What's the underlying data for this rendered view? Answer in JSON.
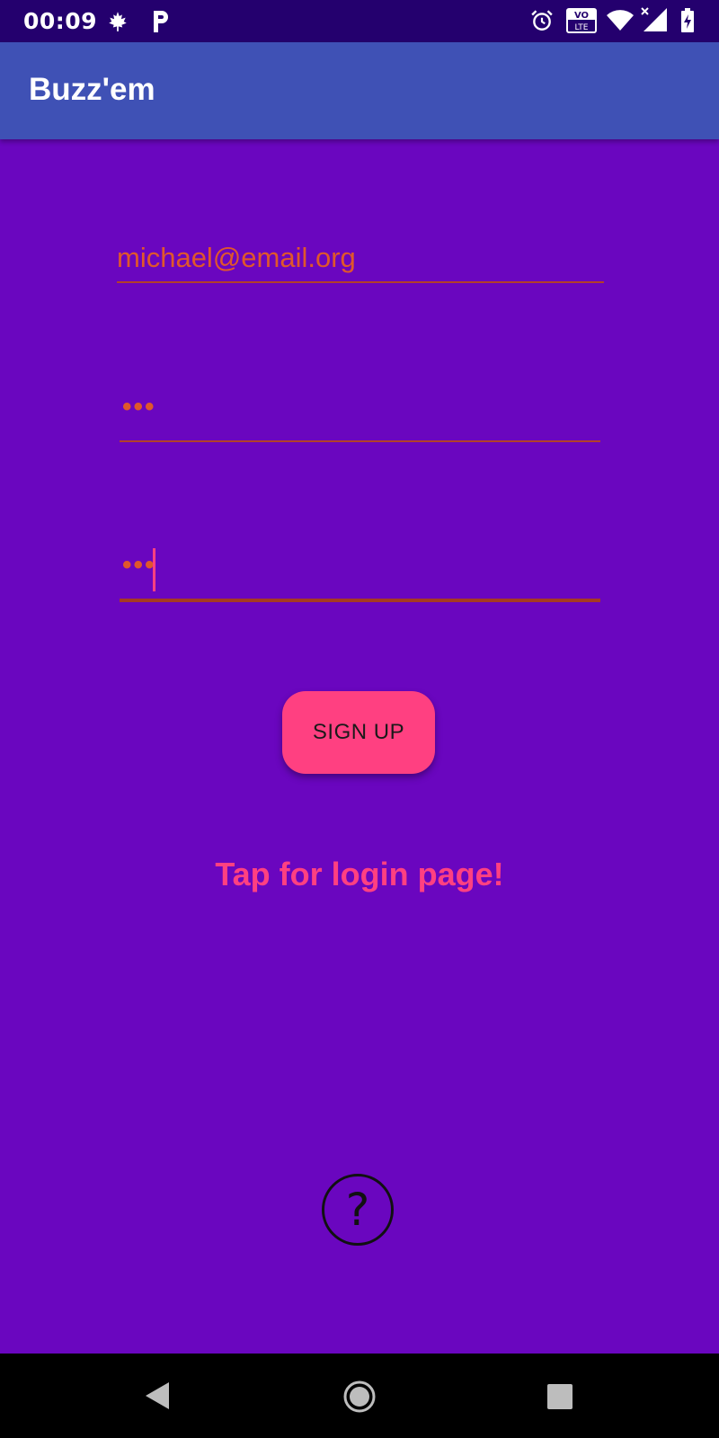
{
  "status_bar": {
    "time": "00:09",
    "icons": [
      "maple-leaf-icon",
      "parking-icon",
      "alarm-icon",
      "volte-icon",
      "wifi-icon",
      "signal-icon",
      "battery-icon"
    ],
    "volte_top": "VO",
    "volte_bottom": "LTE"
  },
  "app_bar": {
    "title": "Buzz'em"
  },
  "form": {
    "email_value": "michael@email.org",
    "password_value": "•••",
    "confirm_password_value": "•••",
    "signup_label": "SIGN UP",
    "login_link": "Tap for login page!"
  },
  "help": {
    "icon": "help-icon",
    "glyph": "?"
  },
  "colors": {
    "background": "#6a06bf",
    "status_bar": "#24006e",
    "app_bar": "#3f51b5",
    "accent": "#ff4081",
    "input_text": "#e0572b"
  },
  "nav_bar": {
    "icons": [
      "back-icon",
      "home-icon",
      "recents-icon"
    ]
  }
}
